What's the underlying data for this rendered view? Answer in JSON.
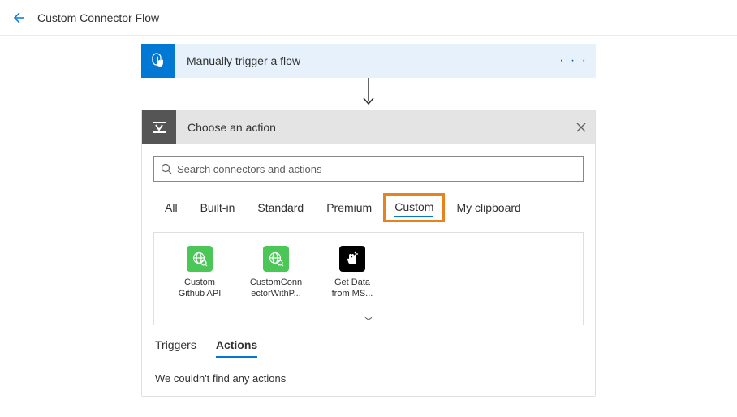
{
  "header": {
    "title": "Custom Connector Flow"
  },
  "trigger": {
    "label": "Manually trigger a flow"
  },
  "panel": {
    "title": "Choose an action"
  },
  "search": {
    "placeholder": "Search connectors and actions"
  },
  "tabs": [
    {
      "label": "All"
    },
    {
      "label": "Built-in"
    },
    {
      "label": "Standard"
    },
    {
      "label": "Premium"
    },
    {
      "label": "Custom",
      "active": true,
      "highlighted": true
    },
    {
      "label": "My clipboard"
    }
  ],
  "connectors": [
    {
      "label_line1": "Custom",
      "label_line2": "Github API",
      "color": "green"
    },
    {
      "label_line1": "CustomConn",
      "label_line2": "ectorWithP...",
      "color": "green"
    },
    {
      "label_line1": "Get Data",
      "label_line2": "from MS...",
      "color": "black"
    }
  ],
  "subtabs": {
    "triggers": "Triggers",
    "actions": "Actions"
  },
  "empty": "We couldn't find any actions"
}
